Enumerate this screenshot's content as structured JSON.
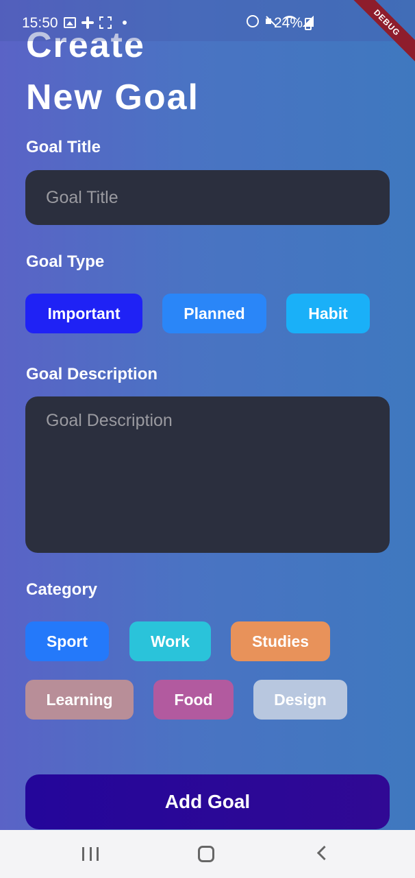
{
  "status_bar": {
    "time": "15:50",
    "battery": "24%",
    "left_icons": [
      "image-icon",
      "slack-icon",
      "grid-icon",
      "dot-icon"
    ],
    "right_icons": [
      "alarm-icon",
      "mute-icon",
      "wifi-icon",
      "signal-icon",
      "battery-icon"
    ]
  },
  "debug_banner": "DEBUG",
  "page": {
    "title_line1": "Create",
    "title_line2": "New Goal"
  },
  "form": {
    "goal_title": {
      "label": "Goal Title",
      "placeholder": "Goal Title",
      "value": ""
    },
    "goal_type": {
      "label": "Goal Type",
      "options": [
        {
          "label": "Important",
          "color": "#1f22f5"
        },
        {
          "label": "Planned",
          "color": "#2a86f8"
        },
        {
          "label": "Habit",
          "color": "#1ab0f8"
        }
      ]
    },
    "goal_description": {
      "label": "Goal Description",
      "placeholder": "Goal Description",
      "value": ""
    },
    "category": {
      "label": "Category",
      "options": [
        {
          "label": "Sport",
          "color": "#2479fa"
        },
        {
          "label": "Work",
          "color": "#2ac3da"
        },
        {
          "label": "Studies",
          "color": "#e8925a"
        },
        {
          "label": "Learning",
          "color": "#b88e98"
        },
        {
          "label": "Food",
          "color": "#b25a9f"
        },
        {
          "label": "Design",
          "color": "#b8c7df"
        }
      ]
    },
    "submit_label": "Add Goal"
  },
  "nav_bar": {
    "icons": [
      "recents-icon",
      "home-icon",
      "back-icon"
    ]
  }
}
